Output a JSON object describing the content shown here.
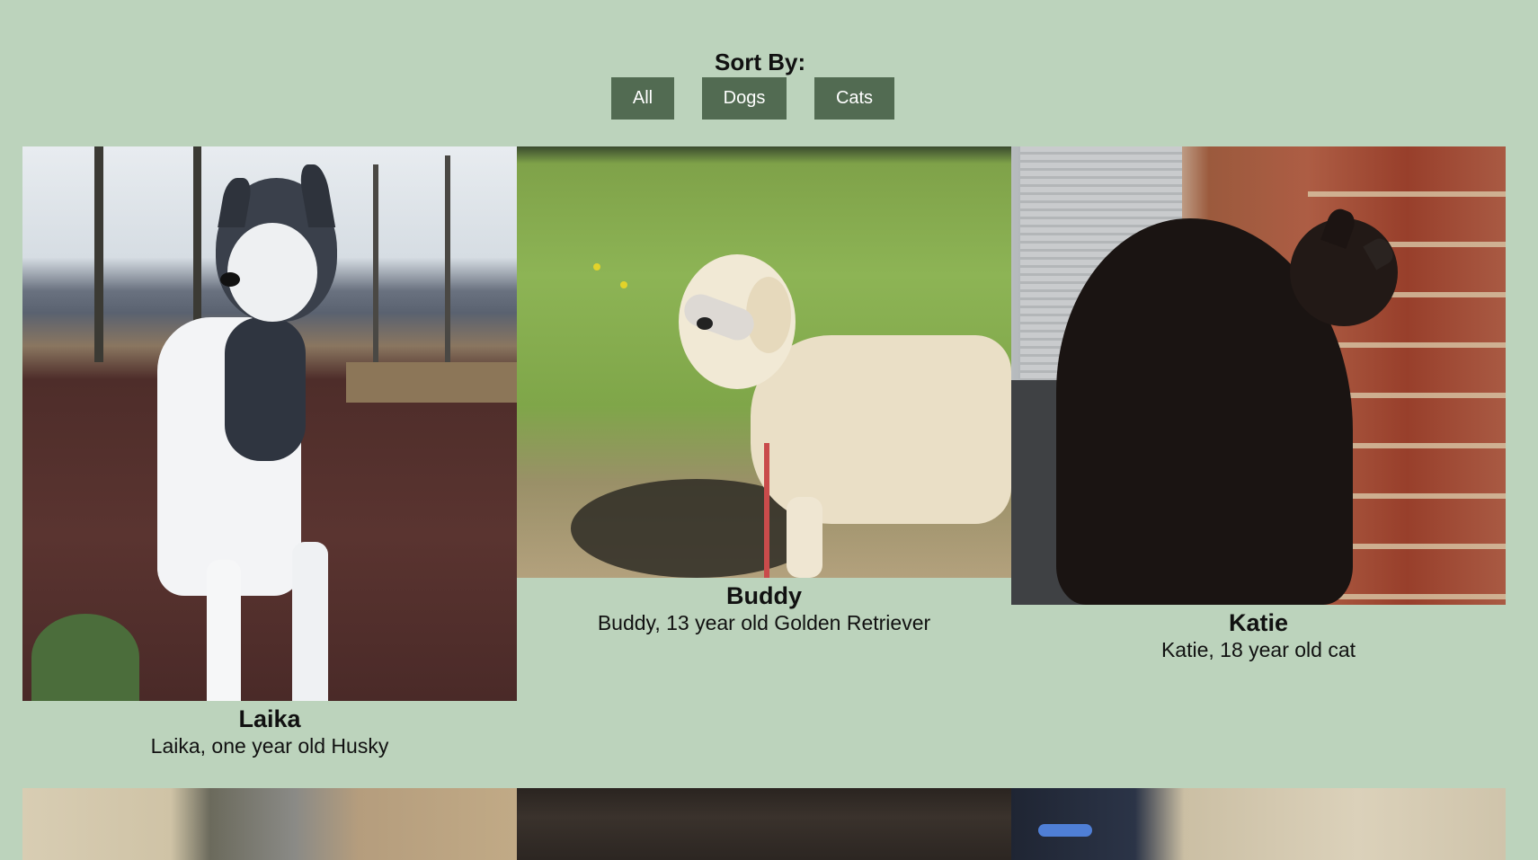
{
  "sort": {
    "title": "Sort By:",
    "buttons": {
      "all": "All",
      "dogs": "Dogs",
      "cats": "Cats"
    }
  },
  "pets": [
    {
      "name": "Laika",
      "description": "Laika, one year old Husky"
    },
    {
      "name": "Buddy",
      "description": "Buddy, 13 year old Golden Retriever"
    },
    {
      "name": "Katie",
      "description": "Katie, 18 year old cat"
    }
  ],
  "colors": {
    "background": "#bcd3bc",
    "button": "#526b52",
    "button_text": "#ffffff"
  }
}
